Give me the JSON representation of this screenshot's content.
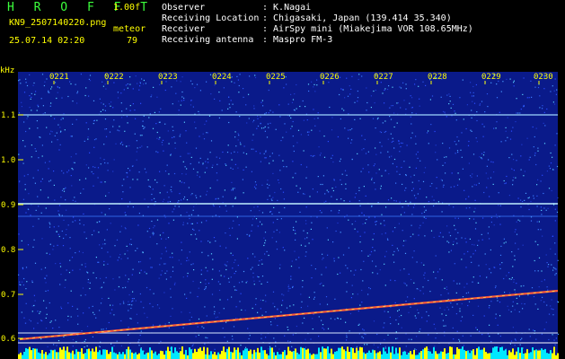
{
  "header": {
    "app_name": "H R O F F T",
    "version": "1.00f",
    "filename": "KN9_2507140220.png",
    "datetime": "25.07.14 02:20",
    "meteor_label": "meteor",
    "meteor_count": "79"
  },
  "info": [
    {
      "key": "Observer",
      "value": ": K.Nagai"
    },
    {
      "key": "Receiving Location",
      "value": ": Chigasaki, Japan (139.414 35.340)"
    },
    {
      "key": "Receiver",
      "value": ": AirSpy mini (Miakejima VOR 108.65MHz)"
    },
    {
      "key": "Receiving antenna",
      "value": ": Maspro FM-3"
    }
  ],
  "axis": {
    "y_unit": "kHz",
    "y_ticks": [
      "1.1",
      "1.0",
      "0.9",
      "0.8",
      "0.7",
      "0.6"
    ],
    "x_ticks": [
      "0221",
      "0222",
      "0223",
      "0224",
      "0225",
      "0226",
      "0227",
      "0228",
      "0229",
      "0230"
    ]
  },
  "colors": {
    "background": "#0a1a8a",
    "label": "#ffff00",
    "title": "#3cff3c"
  }
}
